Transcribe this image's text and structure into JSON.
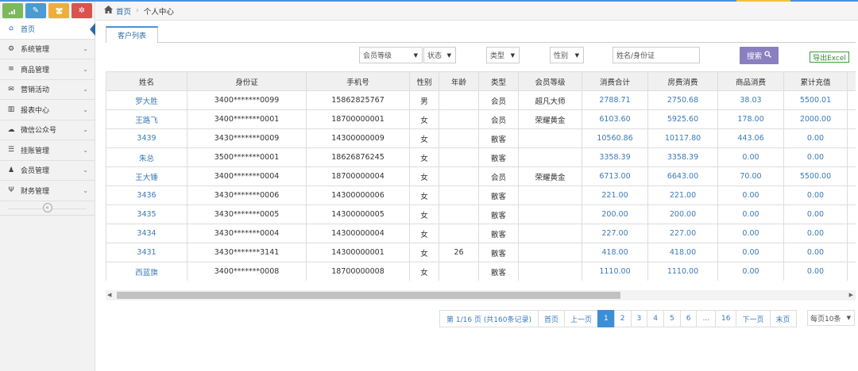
{
  "colors": {
    "accent": "#2c6aa0",
    "link": "#3b7ab8",
    "search_btn": "#8a7fc0",
    "pager_active": "#3b8fd6",
    "export": "#2e8b2e"
  },
  "shortcuts": [
    {
      "icon": "signal-icon",
      "color": "#7cb85c"
    },
    {
      "icon": "pencil-icon",
      "color": "#4a9ad4"
    },
    {
      "icon": "users-icon",
      "color": "#f0ad3c"
    },
    {
      "icon": "cogs-icon",
      "color": "#d9534f"
    }
  ],
  "sidebar": {
    "items": [
      {
        "label": "首页",
        "icon": "home-icon"
      },
      {
        "label": "系统管理",
        "icon": "gear-icon"
      },
      {
        "label": "商品管理",
        "icon": "database-icon"
      },
      {
        "label": "营销活动",
        "icon": "gift-icon"
      },
      {
        "label": "报表中心",
        "icon": "bar-chart-icon"
      },
      {
        "label": "微信公众号",
        "icon": "cloud-icon"
      },
      {
        "label": "挂账管理",
        "icon": "list-icon"
      },
      {
        "label": "会员管理",
        "icon": "group-icon"
      },
      {
        "label": "财务管理",
        "icon": "cutlery-icon"
      }
    ]
  },
  "breadcrumb": {
    "home": "首页",
    "current": "个人中心"
  },
  "tabs": [
    {
      "label": "客户列表"
    }
  ],
  "filters": {
    "member_level": "会员等级",
    "status": "状态",
    "type": "类型",
    "gender": "性别",
    "name_placeholder": "姓名/身份证",
    "search_label": "搜索",
    "export_label": "导出Excel"
  },
  "table": {
    "headers": [
      "姓名",
      "身份证",
      "手机号",
      "性别",
      "年龄",
      "类型",
      "会员等级",
      "消费合计",
      "房费消费",
      "商品消费",
      "累计充值"
    ],
    "rows": [
      [
        "罗大胜",
        "3400*******0099",
        "15862825767",
        "男",
        "",
        "会员",
        "超凡大师",
        "2788.71",
        "2750.68",
        "38.03",
        "5500.01"
      ],
      [
        "王路飞",
        "3400*******0001",
        "18700000001",
        "女",
        "",
        "会员",
        "荣耀黄金",
        "6103.60",
        "5925.60",
        "178.00",
        "2000.00"
      ],
      [
        "3439",
        "3430*******0009",
        "14300000009",
        "女",
        "",
        "散客",
        "",
        "10560.86",
        "10117.80",
        "443.06",
        "0.00"
      ],
      [
        "朱总",
        "3500*******0001",
        "18626876245",
        "女",
        "",
        "散客",
        "",
        "3358.39",
        "3358.39",
        "0.00",
        "0.00"
      ],
      [
        "王大锤",
        "3400*******0004",
        "18700000004",
        "女",
        "",
        "会员",
        "荣耀黄金",
        "6713.00",
        "6643.00",
        "70.00",
        "5500.00"
      ],
      [
        "3436",
        "3430*******0006",
        "14300000006",
        "女",
        "",
        "散客",
        "",
        "221.00",
        "221.00",
        "0.00",
        "0.00"
      ],
      [
        "3435",
        "3430*******0005",
        "14300000005",
        "女",
        "",
        "散客",
        "",
        "200.00",
        "200.00",
        "0.00",
        "0.00"
      ],
      [
        "3434",
        "3430*******0004",
        "14300000004",
        "女",
        "",
        "散客",
        "",
        "227.00",
        "227.00",
        "0.00",
        "0.00"
      ],
      [
        "3431",
        "3430*******3141",
        "14300000001",
        "女",
        "26",
        "散客",
        "",
        "418.00",
        "418.00",
        "0.00",
        "0.00"
      ],
      [
        "西蓝旗",
        "3400*******0008",
        "18700000008",
        "女",
        "",
        "散客",
        "",
        "1110.00",
        "1110.00",
        "0.00",
        "0.00"
      ]
    ]
  },
  "pagination": {
    "info": "第 1/16 页 (共160条记录)",
    "first": "首页",
    "prev": "上一页",
    "pages": [
      "1",
      "2",
      "3",
      "4",
      "5",
      "6",
      "...",
      "16"
    ],
    "current": "1",
    "next": "下一页",
    "last": "末页",
    "per_page": "每页10条"
  }
}
